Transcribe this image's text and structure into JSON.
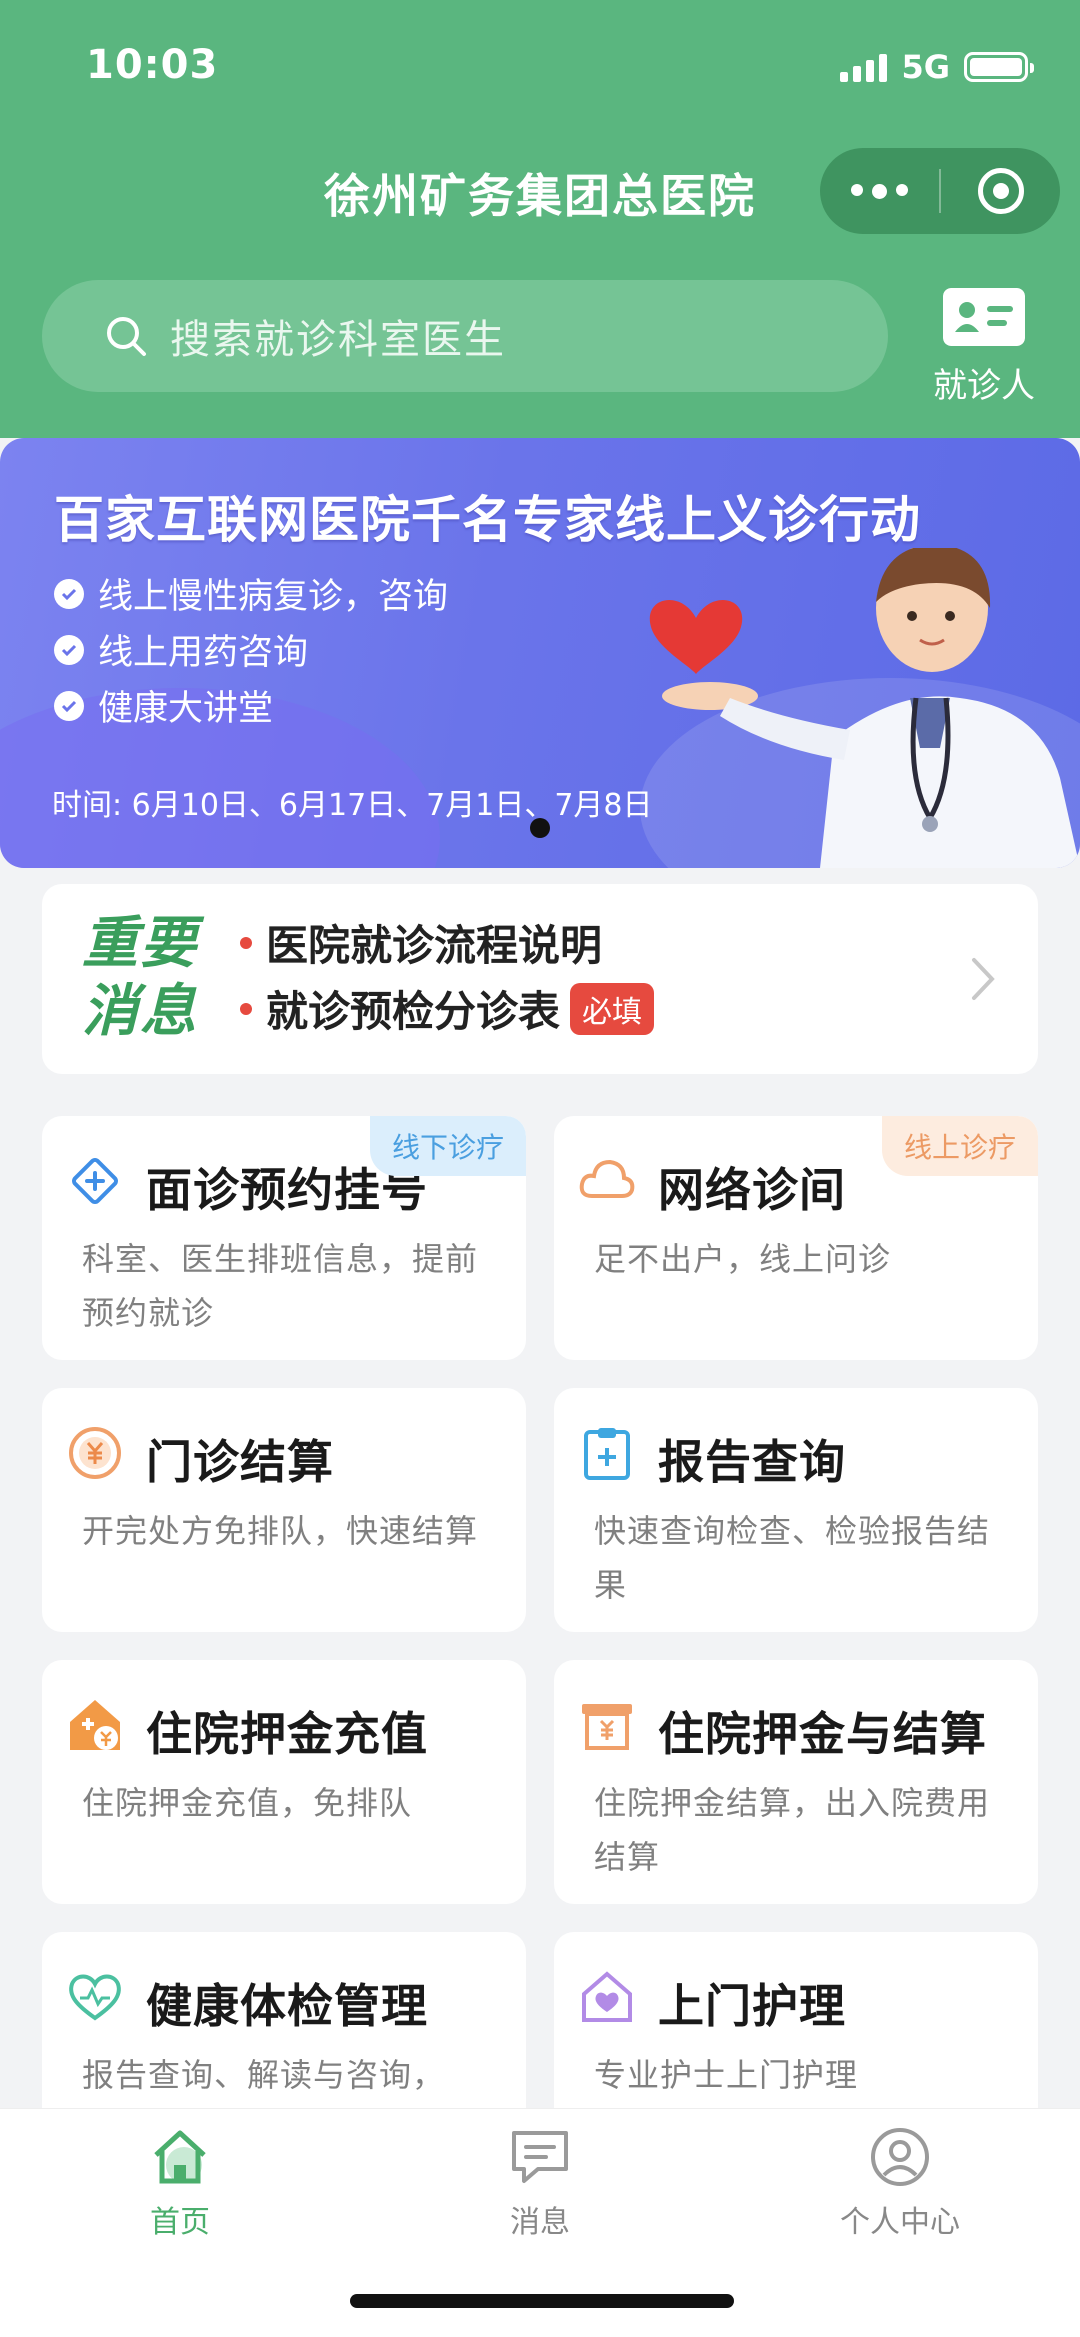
{
  "status": {
    "time": "10:03",
    "network": "5G"
  },
  "header": {
    "title": "徐州矿务集团总医院"
  },
  "search": {
    "placeholder": "搜索就诊科室医生"
  },
  "patient": {
    "label": "就诊人"
  },
  "banner": {
    "title": "百家互联网医院千名专家线上义诊行动",
    "features": [
      "线上慢性病复诊，咨询",
      "线上用药咨询",
      "健康大讲堂"
    ],
    "time": "时间: 6月10日、6月17日、7月1日、7月8日"
  },
  "notice": {
    "tag_line1": "重要",
    "tag_line2": "消息",
    "items": [
      "医院就诊流程说明",
      "就诊预检分诊表"
    ],
    "required_badge": "必填"
  },
  "services": [
    {
      "name": "面诊预约挂号",
      "desc": "科室、医生排班信息，提前预约就诊",
      "badge": "线下诊疗",
      "icon": "diamond-plus-icon"
    },
    {
      "name": "网络诊间",
      "desc": "足不出户，线上问诊",
      "badge": "线上诊疗",
      "icon": "cloud-icon"
    },
    {
      "name": "门诊结算",
      "desc": "开完处方免排队，快速结算",
      "icon": "yuan-coin-icon"
    },
    {
      "name": "报告查询",
      "desc": "快速查询检查、检验报告结果",
      "icon": "clipboard-icon"
    },
    {
      "name": "住院押金充值",
      "desc": "住院押金充值，免排队",
      "icon": "house-yuan-icon"
    },
    {
      "name": "住院押金与结算",
      "desc": "住院押金结算，出入院费用结算",
      "icon": "receipt-icon"
    },
    {
      "name": "健康体检管理",
      "desc": "报告查询、解读与咨询，",
      "icon": "heart-icon"
    },
    {
      "name": "上门护理",
      "desc": "专业护士上门护理",
      "icon": "home-heart-icon"
    }
  ],
  "tabs": [
    {
      "label": "首页",
      "icon": "home-icon",
      "active": true
    },
    {
      "label": "消息",
      "icon": "message-icon",
      "active": false
    },
    {
      "label": "个人中心",
      "icon": "user-icon",
      "active": false
    }
  ],
  "colors": {
    "brand": "#5ab67f",
    "accent_red": "#e64a3f",
    "banner": "#6a74ea"
  }
}
